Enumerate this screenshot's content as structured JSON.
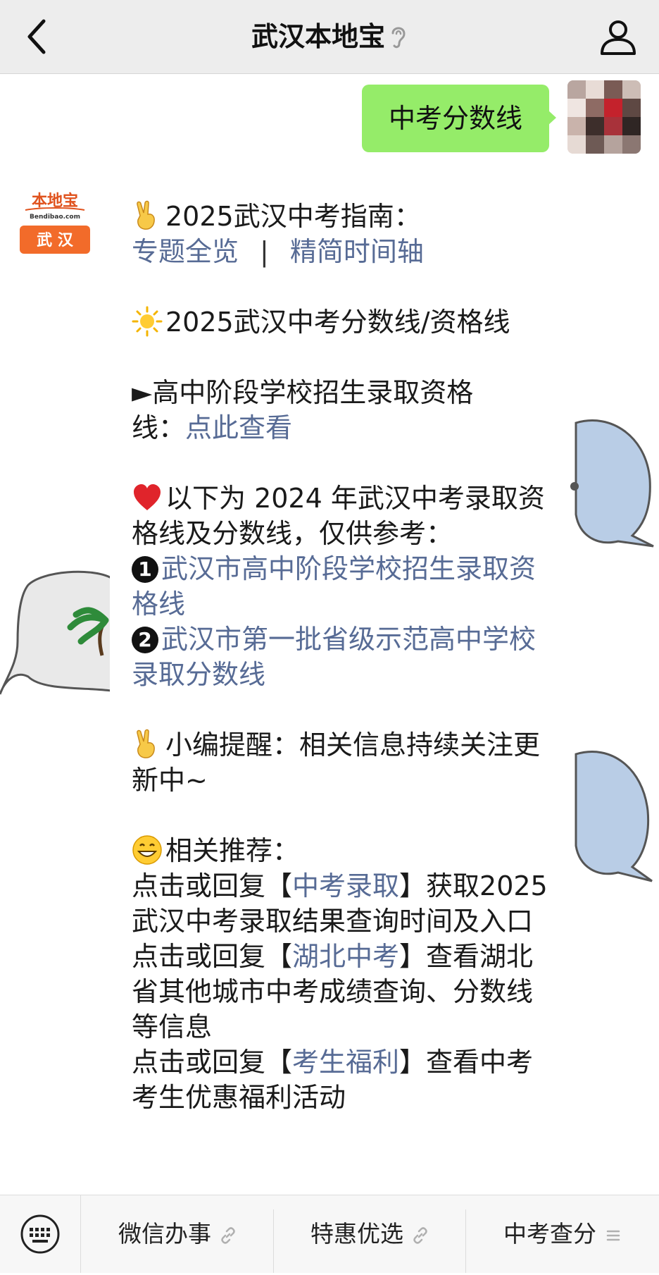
{
  "header": {
    "title": "武汉本地宝"
  },
  "user_message": {
    "text": "中考分数线"
  },
  "official_account": {
    "logo_top": "本地宝",
    "logo_domain": "Bendibao.com",
    "logo_city": "武 汉"
  },
  "message": {
    "guide_title": "2025武汉中考指南：",
    "guide_link_1": "专题全览",
    "guide_sep": "|",
    "guide_link_2": "精简时间轴",
    "score_title": "2025武汉中考分数线/资格线",
    "qual_prefix": "►高中阶段学校招生录取资格",
    "qual_suffix": "线：",
    "qual_link": "点此查看",
    "ref_text": "以下为 2024 年武汉中考录取资格线及分数线，仅供参考：",
    "item1_num": "1",
    "item1_link": "武汉市高中阶段学校招生录取资格线",
    "item2_num": "2",
    "item2_link": "武汉市第一批省级示范高中学校录取分数线",
    "reminder": "小编提醒：相关信息持续关注更新中~",
    "recommend_title": "相关推荐：",
    "rec1_pre": "点击或回复【",
    "rec1_link": "中考录取",
    "rec1_post": "】获取2025武汉中考录取结果查询时间及入口",
    "rec2_pre": "点击或回复【",
    "rec2_link": "湖北中考",
    "rec2_post": "】查看湖北省其他城市中考成绩查询、分数线等信息",
    "rec3_pre": "点击或回复【",
    "rec3_link": "考生福利",
    "rec3_post": "】查看中考考生优惠福利活动"
  },
  "menu": {
    "items": [
      {
        "label": "微信办事",
        "icon": "link-icon"
      },
      {
        "label": "特惠优选",
        "icon": "link-icon"
      },
      {
        "label": "中考查分",
        "icon": "list-icon"
      }
    ]
  },
  "colors": {
    "header_bg": "#ededed",
    "user_bubble": "#95ec69",
    "link": "#576b95",
    "logo_orange": "#f26b2a"
  }
}
